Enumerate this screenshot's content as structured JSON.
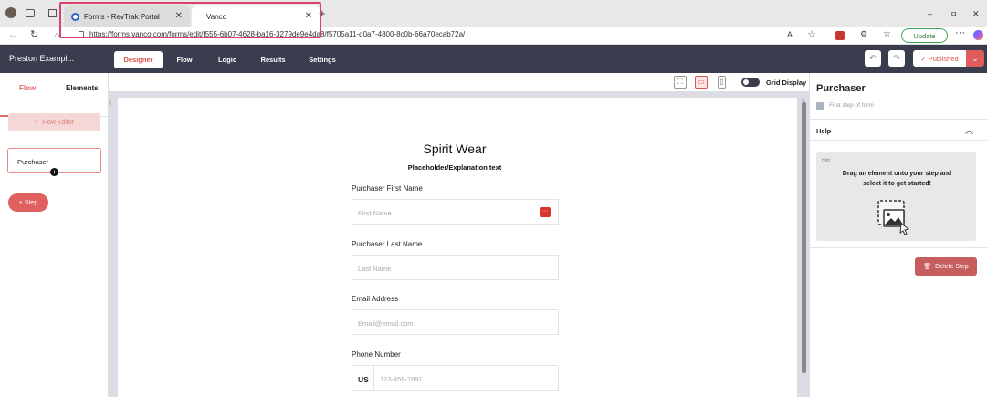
{
  "browser": {
    "tabs": [
      {
        "label": "Forms - RevTrak Portal"
      },
      {
        "label": "Vanco"
      }
    ],
    "new_tab_symbol": "+",
    "url": "https://forms.vanco.com/forms/edit/f555-6b07-4628-ba16-3279de9e4da8/f5705a11-d0a7-4800-8c0b-66a70ecab72a/",
    "update_label": "Update",
    "window_controls": {
      "minimize": "–",
      "maximize": "ㅁ",
      "close": "✕"
    }
  },
  "app": {
    "title": "Preston Exampl...",
    "nav": {
      "designer": "Designer",
      "flow": "Flow",
      "logic": "Logic",
      "results": "Results",
      "settings": "Settings"
    },
    "published_label": "✓ Published"
  },
  "left_panel": {
    "tabs": {
      "flow": "Flow",
      "elements": "Elements"
    },
    "flow_editor_label": "Flow Editor",
    "step_name": "Purchaser",
    "add_step_label": "+ Step"
  },
  "canvas": {
    "grid_display_label": "Grid Display",
    "form": {
      "title": "Spirit Wear",
      "subtitle": "Placeholder/Explanation text",
      "fields": {
        "first_name_label": "Purchaser First Name",
        "first_name_placeholder": "First Name",
        "last_name_label": "Purchaser Last Name",
        "last_name_placeholder": "Last Name",
        "email_label": "Email Address",
        "email_placeholder": "Email@email.com",
        "phone_label": "Phone Number",
        "phone_country": "US",
        "phone_placeholder": "123-456-7891"
      }
    }
  },
  "right_panel": {
    "title": "Purchaser",
    "first_step_label": "First step of form",
    "help_label": "Help",
    "hint_label": "Hint",
    "hint_text": "Drag an element onto your step and select it to get started!",
    "delete_step_label": "Delete Step"
  },
  "colors": {
    "accent": "#e06060",
    "header": "#3a3d4d",
    "highlight": "#d9426b"
  }
}
